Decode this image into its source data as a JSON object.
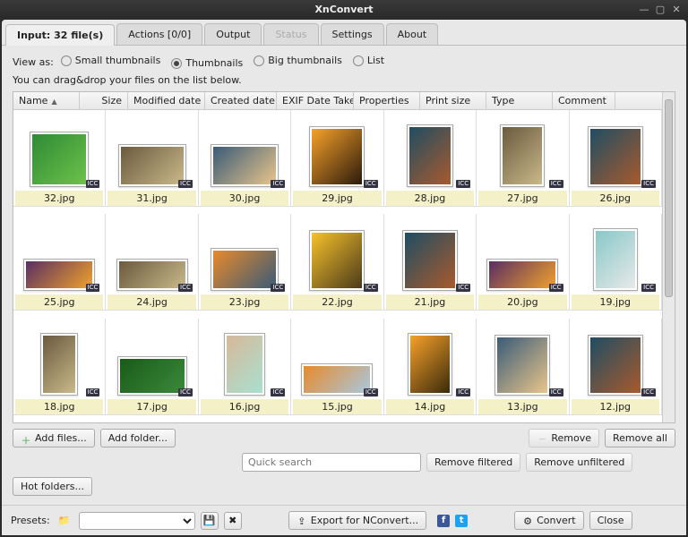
{
  "window": {
    "title": "XnConvert"
  },
  "tabs": [
    {
      "label": "Input: 32 file(s)",
      "active": true
    },
    {
      "label": "Actions [0/0]"
    },
    {
      "label": "Output"
    },
    {
      "label": "Status",
      "disabled": true
    },
    {
      "label": "Settings"
    },
    {
      "label": "About"
    }
  ],
  "view_as": {
    "label": "View as:",
    "options": [
      "Small thumbnails",
      "Thumbnails",
      "Big thumbnails",
      "List"
    ],
    "selected": "Thumbnails"
  },
  "hint": "You can drag&drop your files on the list below.",
  "columns": [
    {
      "label": "Name",
      "w": 74,
      "sort": "▲"
    },
    {
      "label": "Size",
      "w": 54,
      "align": "right"
    },
    {
      "label": "Modified date",
      "w": 86
    },
    {
      "label": "Created date",
      "w": 80
    },
    {
      "label": "EXIF Date Take",
      "w": 86
    },
    {
      "label": "Properties",
      "w": 74
    },
    {
      "label": "Print size",
      "w": 74
    },
    {
      "label": "Type",
      "w": 74
    },
    {
      "label": "Comment",
      "w": 70
    }
  ],
  "files": [
    {
      "name": "32.jpg",
      "w": 60,
      "h": 56,
      "c1": "#2f8a34",
      "c2": "#6cc24a"
    },
    {
      "name": "31.jpg",
      "w": 70,
      "h": 42,
      "c1": "#6b5a3e",
      "c2": "#c9b98a"
    },
    {
      "name": "30.jpg",
      "w": 70,
      "h": 42,
      "c1": "#3a5b78",
      "c2": "#e9c58a"
    },
    {
      "name": "29.jpg",
      "w": 56,
      "h": 62,
      "c1": "#f7a12a",
      "c2": "#2b1a0b"
    },
    {
      "name": "28.jpg",
      "w": 46,
      "h": 64,
      "c1": "#1f4d63",
      "c2": "#a95a2c"
    },
    {
      "name": "27.jpg",
      "w": 44,
      "h": 64,
      "c1": "#6b5a3e",
      "c2": "#c9b98a"
    },
    {
      "name": "26.jpg",
      "w": 56,
      "h": 62,
      "c1": "#1f4d63",
      "c2": "#a95a2c"
    },
    {
      "name": "25.jpg",
      "w": 74,
      "h": 30,
      "c1": "#5a2e63",
      "c2": "#f0a22a"
    },
    {
      "name": "24.jpg",
      "w": 74,
      "h": 30,
      "c1": "#6b5a3e",
      "c2": "#c9b98a"
    },
    {
      "name": "23.jpg",
      "w": 70,
      "h": 42,
      "c1": "#e88a2a",
      "c2": "#3a5b78"
    },
    {
      "name": "22.jpg",
      "w": 56,
      "h": 62,
      "c1": "#f7c12a",
      "c2": "#4a3a1b"
    },
    {
      "name": "21.jpg",
      "w": 56,
      "h": 62,
      "c1": "#1f4d63",
      "c2": "#a95a2c"
    },
    {
      "name": "20.jpg",
      "w": 74,
      "h": 30,
      "c1": "#5a2e63",
      "c2": "#f0a22a"
    },
    {
      "name": "19.jpg",
      "w": 44,
      "h": 64,
      "c1": "#88c8c8",
      "c2": "#e8e8e8"
    },
    {
      "name": "18.jpg",
      "w": 36,
      "h": 64,
      "c1": "#6b5a3e",
      "c2": "#c9b98a"
    },
    {
      "name": "17.jpg",
      "w": 72,
      "h": 38,
      "c1": "#1a5a1a",
      "c2": "#3a8a3a"
    },
    {
      "name": "16.jpg",
      "w": 40,
      "h": 64,
      "c1": "#d8b898",
      "c2": "#a8e0d0"
    },
    {
      "name": "15.jpg",
      "w": 74,
      "h": 30,
      "c1": "#e88a2a",
      "c2": "#a8c8e0"
    },
    {
      "name": "14.jpg",
      "w": 44,
      "h": 64,
      "c1": "#f7a12a",
      "c2": "#3a2a0b"
    },
    {
      "name": "13.jpg",
      "w": 56,
      "h": 62,
      "c1": "#3a5b78",
      "c2": "#e9c58a"
    },
    {
      "name": "12.jpg",
      "w": 56,
      "h": 62,
      "c1": "#1f4d63",
      "c2": "#a95a2c"
    }
  ],
  "icc_badge": "ICC",
  "buttons": {
    "add_files": "Add files...",
    "add_folder": "Add folder...",
    "remove": "Remove",
    "remove_all": "Remove all",
    "remove_filtered": "Remove filtered",
    "remove_unfiltered": "Remove unfiltered",
    "hot_folders": "Hot folders...",
    "export": "Export for NConvert...",
    "convert": "Convert",
    "close": "Close"
  },
  "search": {
    "placeholder": "Quick search"
  },
  "footer": {
    "presets_label": "Presets:"
  }
}
